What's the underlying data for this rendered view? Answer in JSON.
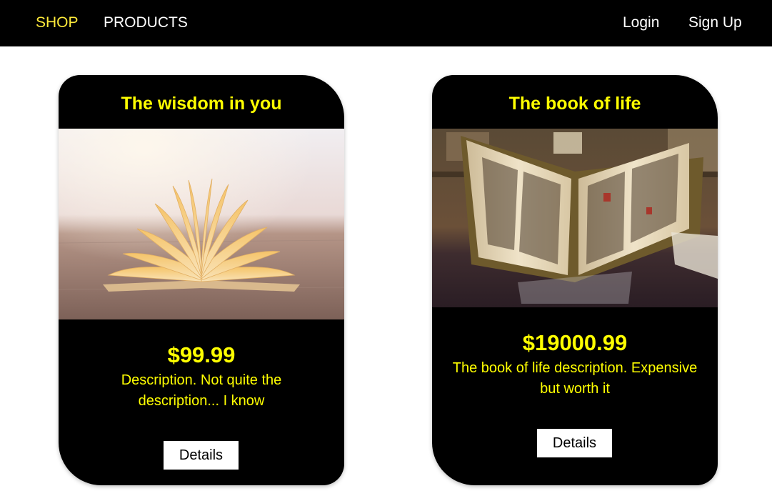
{
  "navbar": {
    "brand_link": "SHOP",
    "products_link": "PRODUCTS",
    "login_link": "Login",
    "signup_link": "Sign Up",
    "active_color": "#ffeb3b"
  },
  "products": [
    {
      "title": "The wisdom in you",
      "image_icon": "open-book-photo",
      "price": "$99.99",
      "description": "Description. Not quite the description... I know",
      "button_label": "Details"
    },
    {
      "title": "The book of life",
      "image_icon": "antique-bible-photo",
      "price": "$19000.99",
      "description": "The book of life description. Expensive but worth it",
      "button_label": "Details"
    }
  ],
  "colors": {
    "card_background": "#000000",
    "accent_text": "#ffff00",
    "button_background": "#ffffff"
  }
}
